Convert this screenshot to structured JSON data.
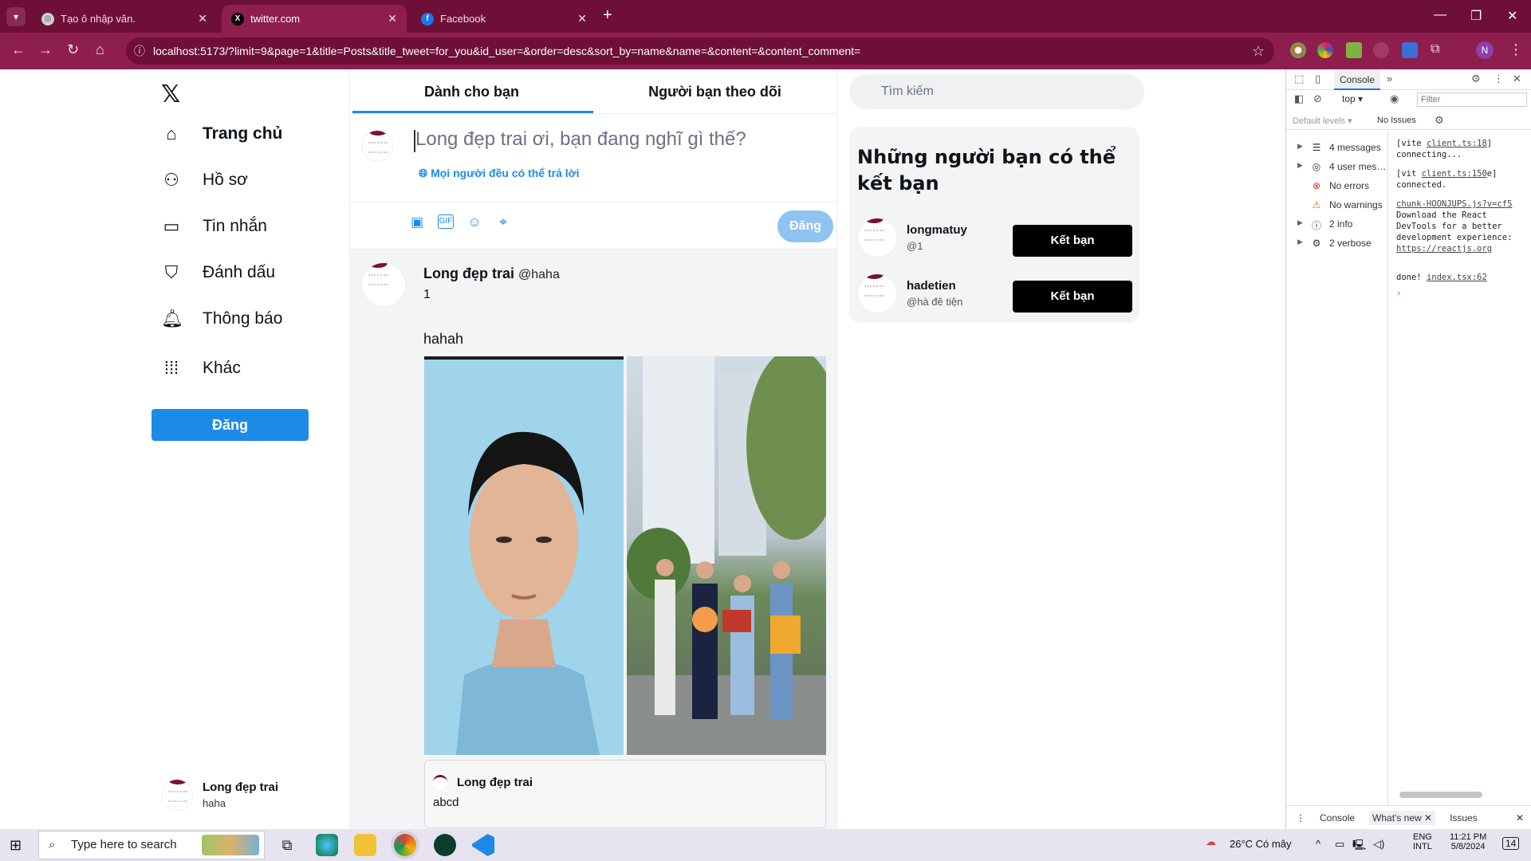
{
  "browser": {
    "tabs": [
      {
        "title": "Tạo ô nhập văn.",
        "favicon": "chatgpt-icon"
      },
      {
        "title": "twitter.com",
        "favicon": "x-logo-icon"
      },
      {
        "title": "Facebook",
        "favicon": "facebook-icon"
      }
    ],
    "url": "localhost:5173/?limit=9&page=1&title=Posts&title_tweet=for_you&id_user=&order=desc&sort_by=name&name=&content=&content_comment="
  },
  "sidebar": {
    "items": [
      {
        "label": "Trang chủ",
        "icon": "home-icon"
      },
      {
        "label": "Hồ sơ",
        "icon": "profile-icon"
      },
      {
        "label": "Tin nhắn",
        "icon": "message-icon"
      },
      {
        "label": "Đánh dấu",
        "icon": "bookmark-icon"
      },
      {
        "label": "Thông báo",
        "icon": "bell-icon"
      },
      {
        "label": "Khác",
        "icon": "more-grid-icon"
      }
    ],
    "post_button": "Đăng",
    "user": {
      "name": "Long đẹp trai",
      "handle": "haha"
    }
  },
  "feed": {
    "tabs": [
      "Dành cho bạn",
      "Người bạn theo dõi"
    ],
    "compose": {
      "placeholder": "Long đẹp trai ơi, bạn đang nghĩ gì thế?",
      "reply_setting": "Mọi người đều có thể trả lời",
      "tools": [
        "image-icon",
        "gif-icon",
        "emoji-icon",
        "location-icon"
      ],
      "submit": "Đăng"
    },
    "tweet": {
      "author": "Long đẹp trai",
      "handle": "@haha",
      "title": "1",
      "body": "hahah",
      "quote": {
        "author": "Long đẹp trai",
        "body": "abcd"
      }
    }
  },
  "right": {
    "search_placeholder": "Tìm kiếm",
    "suggest_title": "Những người bạn có thể kết bạn",
    "suggestions": [
      {
        "name": "longmatuy",
        "handle": "@1",
        "button": "Kết bạn"
      },
      {
        "name": "hadetien",
        "handle": "@hà đê tiện",
        "button": "Kết bạn"
      }
    ]
  },
  "devtools": {
    "tab": "Console",
    "context": "top",
    "filter_placeholder": "Filter",
    "levels": "Default levels",
    "issues": "No Issues",
    "groups": [
      {
        "label": "4 messages",
        "icon": "list-icon"
      },
      {
        "label": "4 user mes…",
        "icon": "user-icon"
      },
      {
        "label": "No errors",
        "icon": "error-icon"
      },
      {
        "label": "No warnings",
        "icon": "warning-icon"
      },
      {
        "label": "2 info",
        "icon": "info-icon"
      },
      {
        "label": "2 verbose",
        "icon": "bug-icon"
      }
    ],
    "log": [
      {
        "text": "[vite ",
        "link": "client.ts:18",
        "rest": "] connecting..."
      },
      {
        "text": "[vit ",
        "link": "client.ts:150",
        "rest": "e] connected."
      },
      {
        "text": "",
        "link": "chunk-HOONJUPS.js?v=cf5",
        "rest": "Download the React DevTools for a better development experience: "
      },
      {
        "text": "",
        "link": "https://reactjs.org",
        "rest": ""
      },
      {
        "text": "done! ",
        "link": "index.tsx:62",
        "rest": ""
      }
    ],
    "bottom_tabs": [
      "Console",
      "What's new",
      "Issues"
    ]
  },
  "taskbar": {
    "search_placeholder": "Type here to search",
    "weather": "26°C  Có mây",
    "lang1": "ENG",
    "lang2": "INTL",
    "time": "11:21 PM",
    "date": "5/8/2024",
    "notif_count": "14"
  },
  "colors": {
    "chrome": "#8e1e4d",
    "accent": "#1d8ae8",
    "follow": "#000000"
  }
}
